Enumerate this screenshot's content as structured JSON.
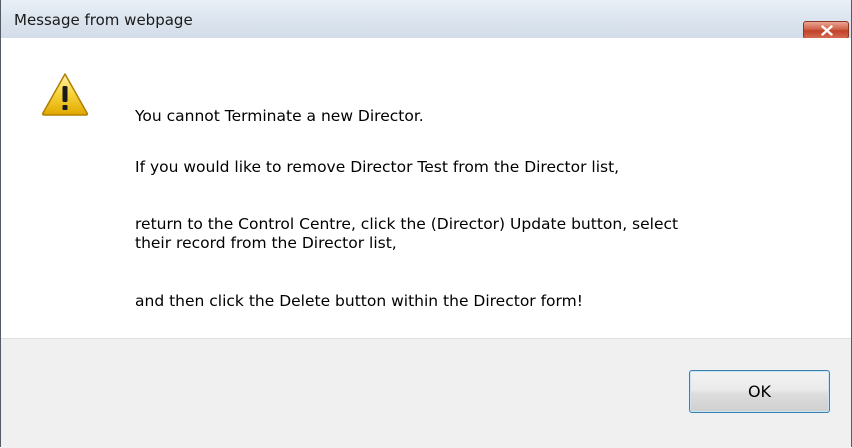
{
  "window": {
    "title": "Message from webpage",
    "close_icon": "close-icon"
  },
  "message": {
    "icon": "warning-icon",
    "line1": "You cannot Terminate a new Director.",
    "line2": "If you would like to remove Director Test from the Director list,",
    "line3a": "return to the Control Centre, click the (Director) Update button, select",
    "line3b": "their record from the Director list,",
    "line4": "and then click the Delete button within the Director form!"
  },
  "buttons": {
    "ok_label": "OK"
  },
  "colors": {
    "close_button": "#c7432b",
    "ok_border": "#3c7fb1",
    "warning": "#f5c518"
  }
}
